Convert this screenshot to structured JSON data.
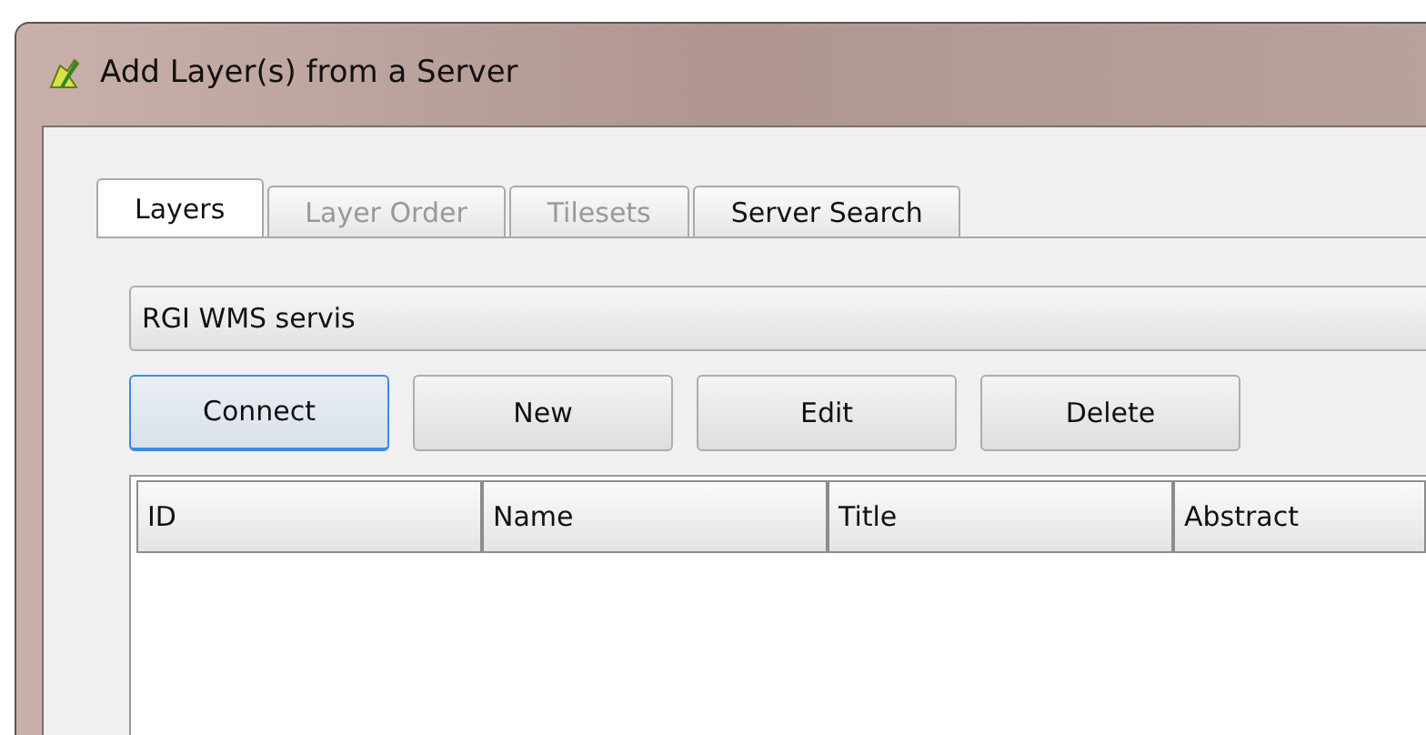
{
  "window": {
    "title": "Add Layer(s) from a Server"
  },
  "tabs": [
    {
      "label": "Layers",
      "selected": true,
      "disabled": false
    },
    {
      "label": "Layer Order",
      "selected": false,
      "disabled": true
    },
    {
      "label": "Tilesets",
      "selected": false,
      "disabled": true
    },
    {
      "label": "Server Search",
      "selected": false,
      "disabled": false
    }
  ],
  "connection": {
    "value": "RGI WMS servis"
  },
  "buttons": [
    {
      "label": "Connect",
      "selected": true
    },
    {
      "label": "New",
      "selected": false
    },
    {
      "label": "Edit",
      "selected": false
    },
    {
      "label": "Delete",
      "selected": false
    }
  ],
  "table": {
    "columns": [
      "ID",
      "Name",
      "Title",
      "Abstract"
    ]
  }
}
